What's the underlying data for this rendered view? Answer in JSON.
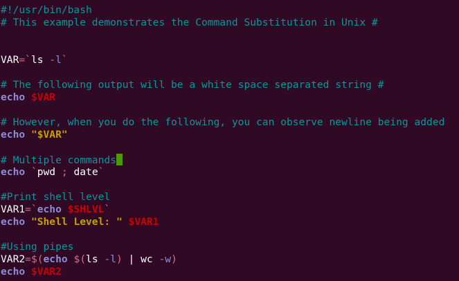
{
  "editor": {
    "lines": [
      {
        "segments": [
          {
            "t": "comment",
            "text": "#!/usr/bin/bash"
          }
        ]
      },
      {
        "segments": [
          {
            "t": "comment",
            "text": "# This example demonstrates the Command Substitution in Unix #"
          }
        ]
      },
      {
        "segments": []
      },
      {
        "segments": []
      },
      {
        "segments": [
          {
            "t": "plain",
            "text": "VAR"
          },
          {
            "t": "op",
            "text": "=`"
          },
          {
            "t": "plain",
            "text": "ls "
          },
          {
            "t": "dim",
            "text": "-l"
          },
          {
            "t": "op",
            "text": "`"
          }
        ]
      },
      {
        "segments": []
      },
      {
        "segments": [
          {
            "t": "comment",
            "text": "# The following output will be a white space separated string #"
          }
        ]
      },
      {
        "segments": [
          {
            "t": "keyword",
            "text": "echo "
          },
          {
            "t": "varref",
            "text": "$VAR"
          }
        ]
      },
      {
        "segments": []
      },
      {
        "segments": [
          {
            "t": "comment",
            "text": "# However, when you do the following, you can observe newline being added"
          }
        ]
      },
      {
        "segments": [
          {
            "t": "keyword",
            "text": "echo "
          },
          {
            "t": "str",
            "text": "\"$VAR\""
          }
        ]
      },
      {
        "segments": []
      },
      {
        "segments": [
          {
            "t": "comment",
            "text": "# Multiple commands"
          },
          {
            "t": "cursor",
            "text": ""
          }
        ]
      },
      {
        "segments": [
          {
            "t": "keyword",
            "text": "echo "
          },
          {
            "t": "op",
            "text": "`"
          },
          {
            "t": "plain",
            "text": "pwd "
          },
          {
            "t": "op",
            "text": "; "
          },
          {
            "t": "plain",
            "text": "date"
          },
          {
            "t": "op",
            "text": "`"
          }
        ]
      },
      {
        "segments": []
      },
      {
        "segments": [
          {
            "t": "comment",
            "text": "#Print shell level"
          }
        ]
      },
      {
        "segments": [
          {
            "t": "plain",
            "text": "VAR1"
          },
          {
            "t": "op",
            "text": "=`"
          },
          {
            "t": "keyword",
            "text": "echo "
          },
          {
            "t": "varref",
            "text": "$SHLVL"
          },
          {
            "t": "op",
            "text": "`"
          }
        ]
      },
      {
        "segments": [
          {
            "t": "keyword",
            "text": "echo "
          },
          {
            "t": "str",
            "text": "\"Shell Level: \" "
          },
          {
            "t": "varref",
            "text": "$VAR1"
          }
        ]
      },
      {
        "segments": []
      },
      {
        "segments": [
          {
            "t": "comment",
            "text": "#Using pipes"
          }
        ]
      },
      {
        "segments": [
          {
            "t": "plain",
            "text": "VAR2"
          },
          {
            "t": "op",
            "text": "=$("
          },
          {
            "t": "keyword",
            "text": "echo "
          },
          {
            "t": "op",
            "text": "$("
          },
          {
            "t": "plain",
            "text": "ls "
          },
          {
            "t": "dim",
            "text": "-l"
          },
          {
            "t": "op",
            "text": ") "
          },
          {
            "t": "plain",
            "text": "| wc "
          },
          {
            "t": "dim",
            "text": "-w"
          },
          {
            "t": "op",
            "text": ")"
          }
        ]
      },
      {
        "segments": [
          {
            "t": "keyword",
            "text": "echo "
          },
          {
            "t": "varref",
            "text": "$VAR2"
          }
        ]
      }
    ]
  },
  "colors": {
    "background": "#300a24",
    "comment": "#06989a",
    "keyword": "#8c8cd9",
    "variable": "#cc0000",
    "string": "#c4a000",
    "operator": "#dd6a83",
    "cursor": "#4e9a06"
  }
}
